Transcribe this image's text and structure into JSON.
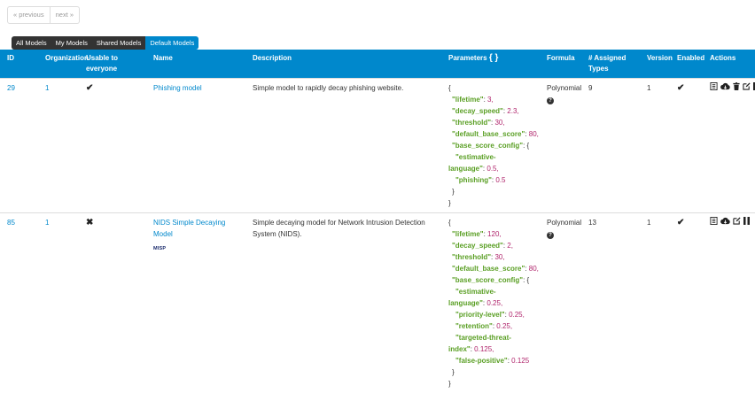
{
  "pager": {
    "previous": "« previous",
    "next": "next »"
  },
  "filters": [
    "All Models",
    "My Models",
    "Shared Models",
    "Default Models"
  ],
  "columns": {
    "id": "ID",
    "organization": "Organization",
    "usable": "Usable to everyone",
    "name": "Name",
    "description": "Description",
    "parameters": "Parameters",
    "parameters_brace": "{ }",
    "formula": "Formula",
    "assigned": "# Assigned Types",
    "version": "Version",
    "enabled": "Enabled",
    "actions": "Actions"
  },
  "rows": [
    {
      "id": "29",
      "organization": "1",
      "usable": "✔",
      "name": "Phishing model",
      "description": "Simple model to rapidly decay phishing website.",
      "formula": "Polynomial",
      "assigned": "9",
      "version": "1",
      "enabled": "✔",
      "logo": "",
      "params": [
        {
          "k": "",
          "v": "",
          "t": "{"
        },
        {
          "k": "\"lifetime\"",
          "v": "3,",
          "t": ""
        },
        {
          "k": "\"decay_speed\"",
          "v": "2.3,",
          "t": ""
        },
        {
          "k": "\"threshold\"",
          "v": "30,",
          "t": ""
        },
        {
          "k": "\"default_base_score\"",
          "v": "80,",
          "t": ""
        },
        {
          "k": "\"base_score_config\"",
          "v": "",
          "t": ": {"
        },
        {
          "k": "\"estimative-",
          "v": "",
          "t": ""
        },
        {
          "k": "language\"",
          "v": "0.5,",
          "t": ""
        },
        {
          "k": "\"phishing\"",
          "v": "0.5",
          "t": ""
        },
        {
          "k": "",
          "v": "",
          "t": "}"
        },
        {
          "k": "",
          "v": "",
          "t": "}"
        }
      ]
    },
    {
      "id": "85",
      "organization": "1",
      "usable": "✖",
      "name": "NIDS Simple Decaying Model",
      "description": "Simple decaying model for Network Intrusion Detection System (NIDS).",
      "formula": "Polynomial",
      "assigned": "13",
      "version": "1",
      "enabled": "✔",
      "logo": "MISP",
      "params": [
        {
          "k": "",
          "v": "",
          "t": "{"
        },
        {
          "k": "\"lifetime\"",
          "v": "120,",
          "t": ""
        },
        {
          "k": "\"decay_speed\"",
          "v": "2,",
          "t": ""
        },
        {
          "k": "\"threshold\"",
          "v": "30,",
          "t": ""
        },
        {
          "k": "\"default_base_score\"",
          "v": "80,",
          "t": ""
        },
        {
          "k": "\"base_score_config\"",
          "v": "",
          "t": ": {"
        },
        {
          "k": "\"estimative-",
          "v": "",
          "t": ""
        },
        {
          "k": "language\"",
          "v": "0.25,",
          "t": ""
        },
        {
          "k": "\"priority-level\"",
          "v": "0.25,",
          "t": ""
        },
        {
          "k": "\"retention\"",
          "v": "0.25,",
          "t": ""
        },
        {
          "k": "\"targeted-threat-",
          "v": "",
          "t": ""
        },
        {
          "k": "index\"",
          "v": "0.125,",
          "t": ""
        },
        {
          "k": "\"false-positive\"",
          "v": "0.125",
          "t": ""
        },
        {
          "k": "",
          "v": "",
          "t": "}"
        },
        {
          "k": "",
          "v": "",
          "t": "}"
        }
      ]
    }
  ]
}
